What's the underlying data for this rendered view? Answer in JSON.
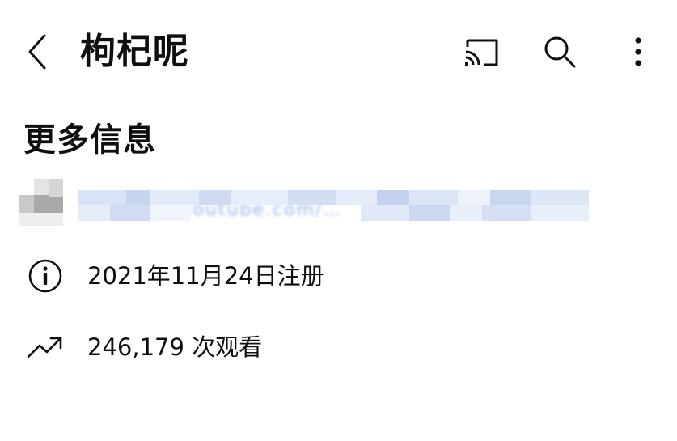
{
  "header": {
    "title": "枸杞呢",
    "icons": {
      "back": "back-arrow-icon",
      "cast": "cast-icon",
      "search": "search-icon",
      "more": "more-vertical-icon"
    }
  },
  "section": {
    "title": "更多信息"
  },
  "link": {
    "redacted": true,
    "visible_fragment": "…myoutube.com/…",
    "color": "#3a6fd4"
  },
  "info": {
    "joined": {
      "icon": "info-icon",
      "text": "2021年11月24日注册"
    },
    "views": {
      "icon": "trending-icon",
      "text": "246,179 次观看"
    }
  }
}
